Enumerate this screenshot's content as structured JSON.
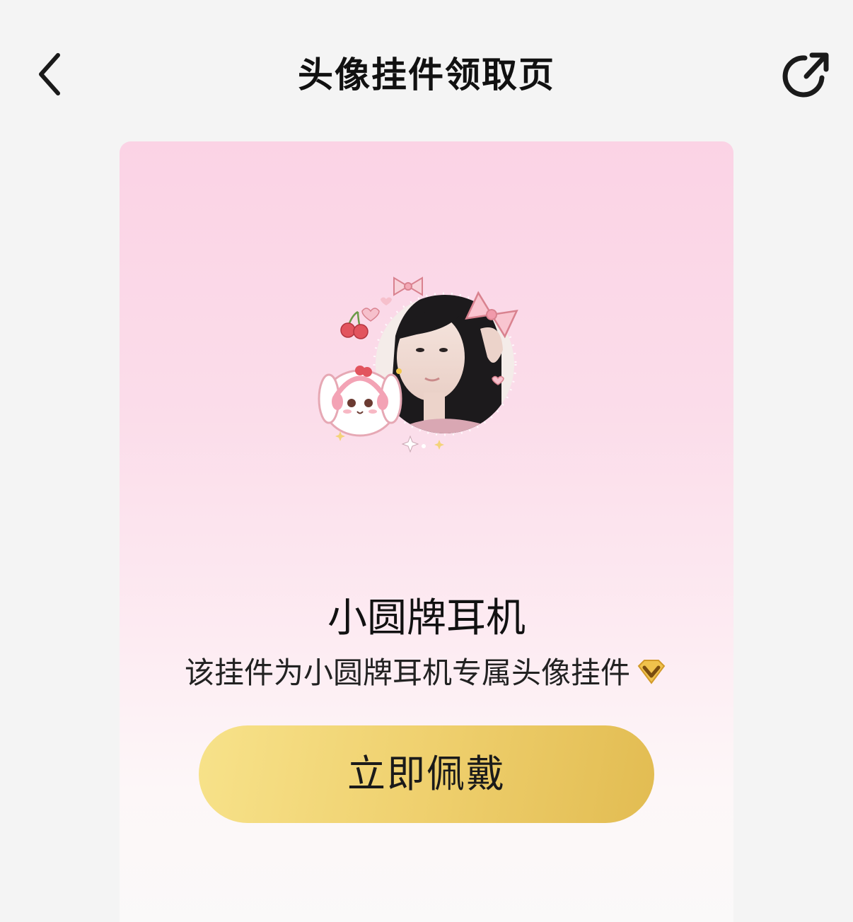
{
  "header": {
    "title": "头像挂件领取页",
    "back_icon": "chevron-left-icon",
    "share_icon": "share-external-icon"
  },
  "pendant": {
    "name": "小圆牌耳机",
    "description": "该挂件为小圆牌耳机专属头像挂件",
    "badge_icon": "vip-diamond-icon",
    "wear_button_label": "立即佩戴"
  },
  "colors": {
    "background": "#f4f4f4",
    "card_top": "#fbd3e5",
    "card_bottom": "#faf9f9",
    "button_gold": "#efd06e",
    "badge_gold": "#e8b43c"
  }
}
